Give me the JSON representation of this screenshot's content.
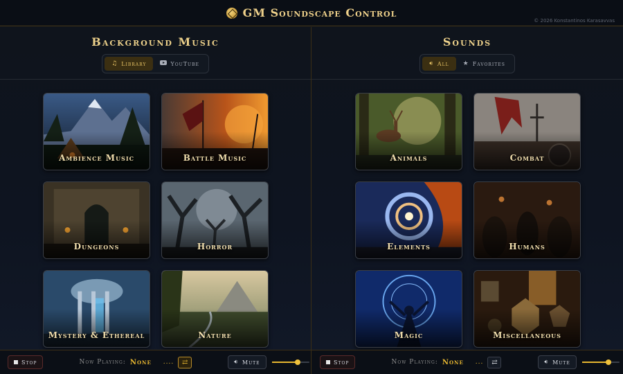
{
  "header": {
    "title": "GM Soundscape Control",
    "copyright": "© 2026 Konstantinos Karasavvas"
  },
  "music": {
    "title": "Background Music",
    "tabs": [
      {
        "label": "Library",
        "icon": "music-note-icon",
        "active": true
      },
      {
        "label": "YouTube",
        "icon": "youtube-icon",
        "active": false
      }
    ],
    "cards": [
      {
        "label": "Ambience Music"
      },
      {
        "label": "Battle Music"
      },
      {
        "label": "Dungeons"
      },
      {
        "label": "Horror"
      },
      {
        "label": "Mystery & Ethereal"
      },
      {
        "label": "Nature"
      }
    ],
    "player": {
      "stop_label": "Stop",
      "now_playing_label": "Now Playing:",
      "now_playing_value": "None",
      "dots": "....",
      "repeat_active": true,
      "mute_label": "Mute",
      "volume": 0.7
    }
  },
  "sounds": {
    "title": "Sounds",
    "tabs": [
      {
        "label": "All",
        "icon": "speaker-icon",
        "active": true
      },
      {
        "label": "Favorites",
        "icon": "star-icon",
        "active": false
      }
    ],
    "cards": [
      {
        "label": "Animals"
      },
      {
        "label": "Combat"
      },
      {
        "label": "Elements"
      },
      {
        "label": "Humans"
      },
      {
        "label": "Magic"
      },
      {
        "label": "Miscellaneous"
      }
    ],
    "player": {
      "stop_label": "Stop",
      "now_playing_label": "Now Playing:",
      "now_playing_value": "None",
      "dots": "...",
      "repeat_active": false,
      "mute_label": "Mute",
      "volume": 0.7
    }
  },
  "colors": {
    "accent": "#e8b730",
    "background": "#0d1118",
    "title_gold": "#ecd08a"
  }
}
